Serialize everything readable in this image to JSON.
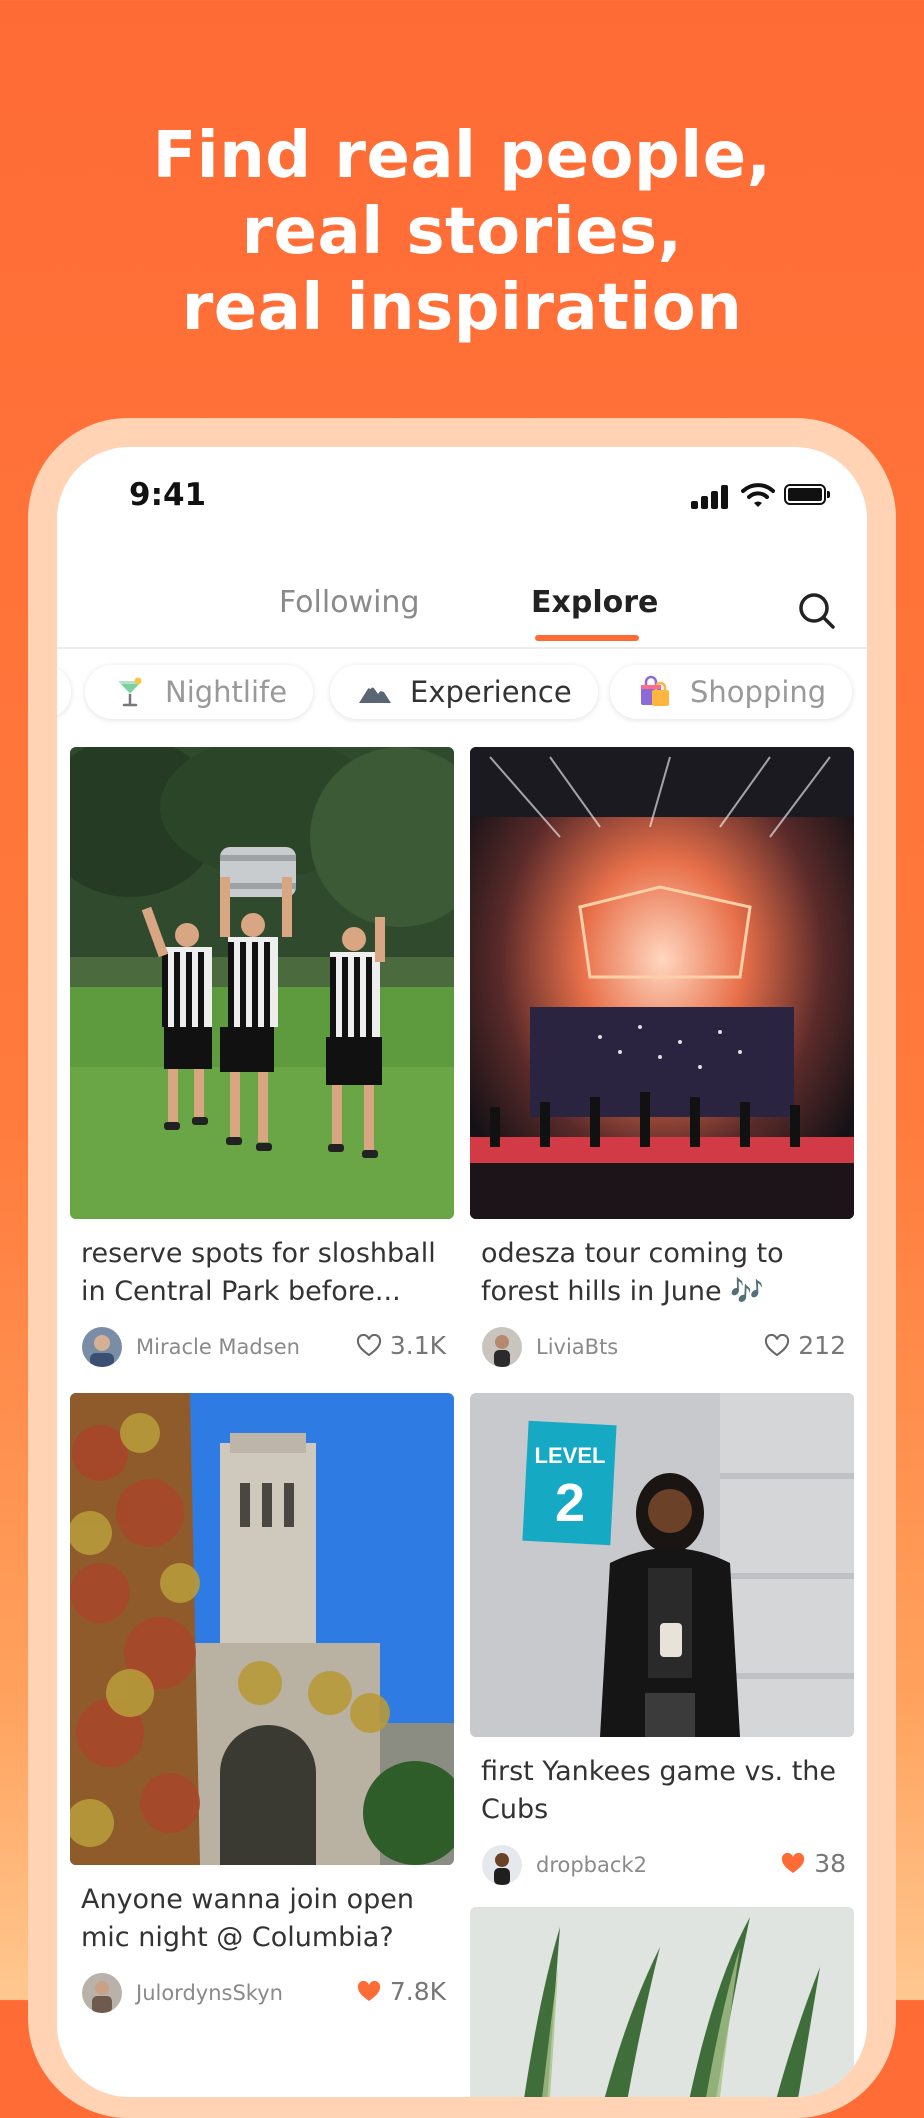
{
  "headline": {
    "line1": "Find real people,",
    "line2": "real stories,",
    "line3": "real inspiration"
  },
  "status_bar": {
    "time": "9:41"
  },
  "tabs": {
    "following": "Following",
    "explore": "Explore"
  },
  "categories": [
    {
      "label": "Nightlife",
      "icon": "cocktail-icon"
    },
    {
      "label": "Experience",
      "icon": "mountain-icon"
    },
    {
      "label": "Shopping",
      "icon": "shopping-bag-icon"
    }
  ],
  "posts": [
    {
      "title": "reserve spots for sloshball in Central Park before...",
      "user": "Miracle Madsen",
      "likes": "3.1K",
      "liked": false
    },
    {
      "title": "odesza tour coming to forest hills in June 🎶",
      "user": "LiviaBts",
      "likes": "212",
      "liked": false
    },
    {
      "title": "Anyone wanna join open mic night @ Columbia?",
      "user": "JulordynsSkyn",
      "likes": "7.8K",
      "liked": true
    },
    {
      "title": "first Yankees game vs. the Cubs",
      "user": "dropback2",
      "likes": "38",
      "liked": true
    }
  ],
  "photo_text": {
    "level_sign_word": "LEVEL",
    "level_sign_number": "2"
  },
  "colors": {
    "accent": "#ff6b35",
    "liked_heart": "#ff6b35"
  }
}
